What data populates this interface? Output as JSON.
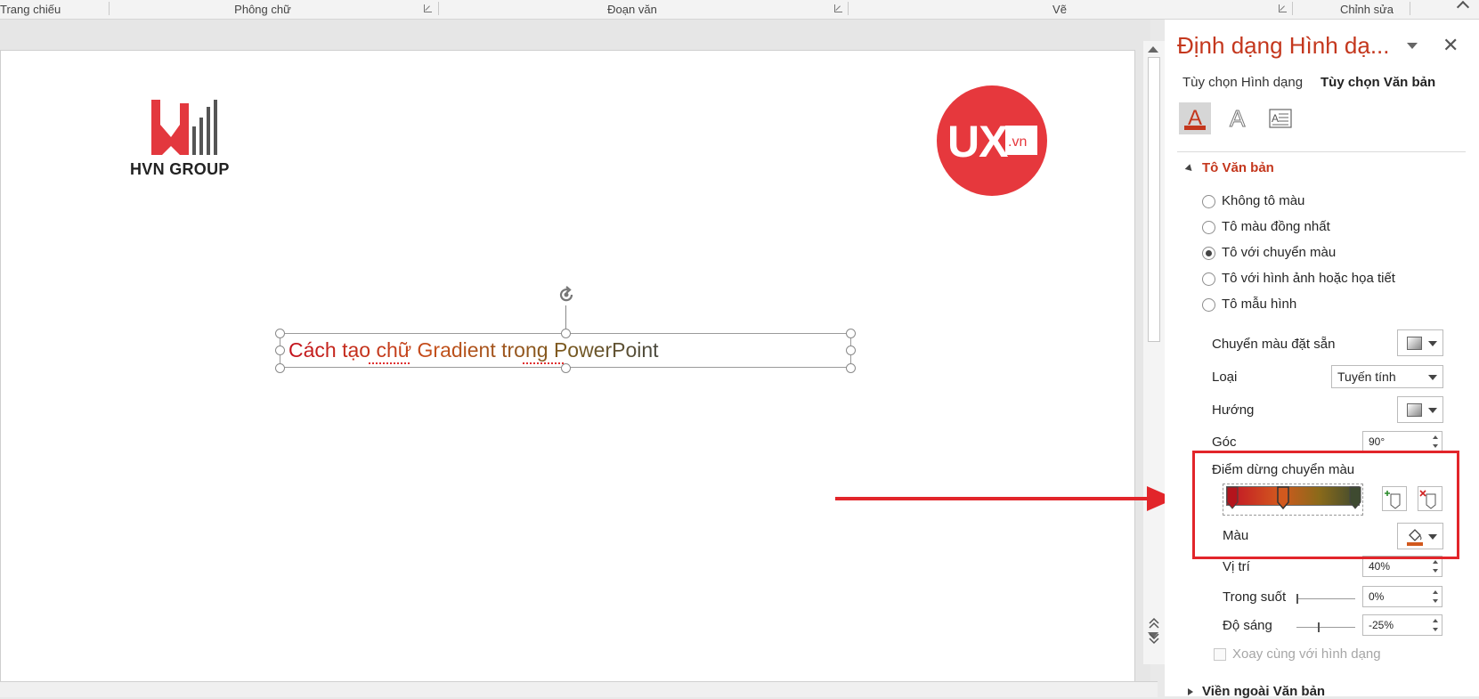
{
  "ribbon": {
    "groups": [
      "Trang chiếu",
      "Phông chữ",
      "Đoạn văn",
      "Vẽ",
      "Chỉnh sửa"
    ]
  },
  "slide": {
    "hvn_logo_text": "HVN GROUP",
    "ux_logo_text": "UX",
    "ux_logo_suffix": ".vn",
    "textbox_text": "Cách tạo chữ Gradient trong PowerPoint"
  },
  "pane": {
    "title": "Định dạng Hình dạ...",
    "close_glyph": "✕",
    "tabs": [
      "Tùy chọn Hình dạng",
      "Tùy chọn Văn bản"
    ],
    "active_tab": "Tùy chọn Văn bản",
    "icon_tabs": [
      "text-fill-outline-icon",
      "text-effects-icon",
      "textbox-icon"
    ],
    "section": "Tô Văn bản",
    "fill_options": [
      {
        "label": "Không tô màu",
        "selected": false
      },
      {
        "label": "Tô màu đồng nhất",
        "selected": false
      },
      {
        "label": "Tô với chuyển màu",
        "selected": true
      },
      {
        "label": "Tô với hình ảnh hoặc họa tiết",
        "selected": false
      },
      {
        "label": "Tô mẫu hình",
        "selected": false
      }
    ],
    "preset_gradient_label": "Chuyển màu đặt sẵn",
    "type_label": "Loại",
    "type_value": "Tuyến tính",
    "direction_label": "Hướng",
    "angle_label": "Góc",
    "angle_value": "90°",
    "gradient_stops_label": "Điểm dừng chuyển màu",
    "color_label": "Màu",
    "position_label": "Vị trí",
    "position_value": "40%",
    "transparency_label": "Trong suốt",
    "transparency_value": "0%",
    "brightness_label": "Độ sáng",
    "brightness_value": "-25%",
    "rotate_with_shape_label": "Xoay cùng với hình dạng",
    "outline_section": "Viền ngoài Văn bản",
    "accent_color": "#c4371d",
    "highlight_color": "#e2252a"
  }
}
